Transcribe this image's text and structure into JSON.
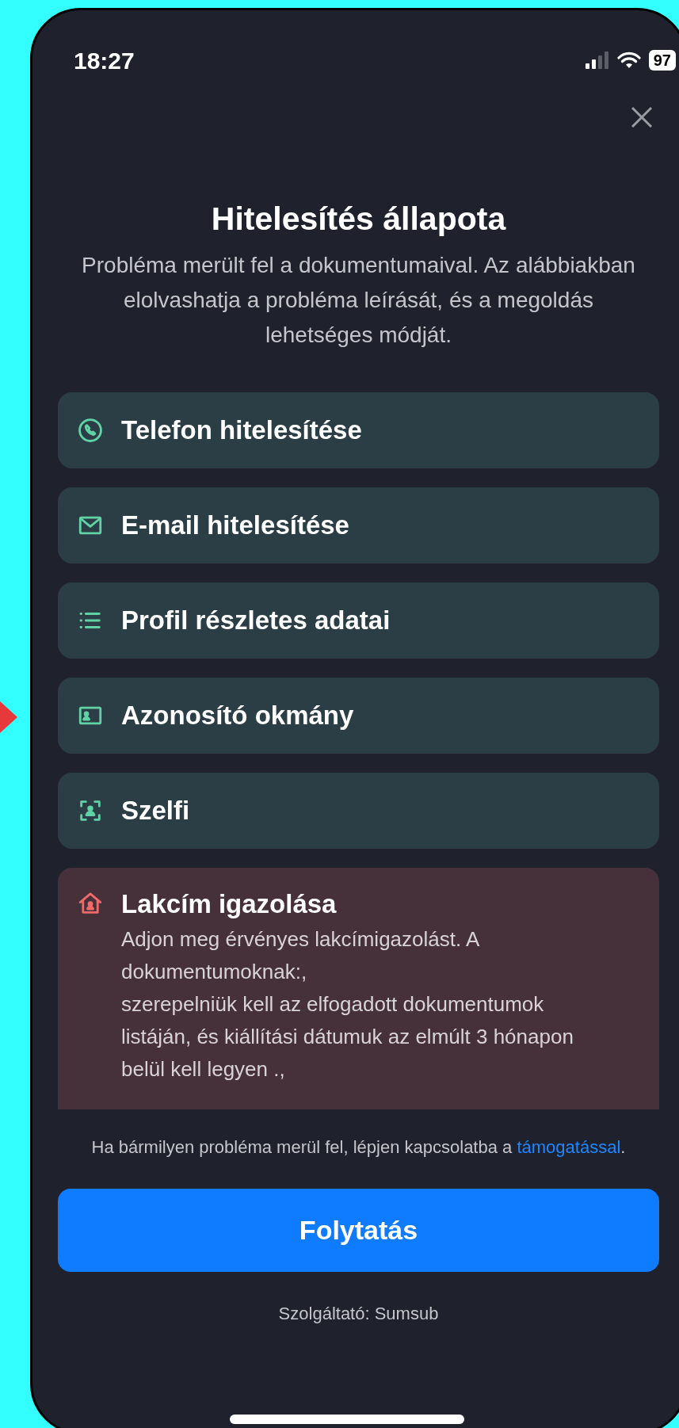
{
  "status_bar": {
    "time": "18:27",
    "battery": "97"
  },
  "title": "Hitelesítés állapota",
  "subtitle": "Probléma merült fel a dokumentumaival. Az alábbiakban elolvashatja a probléma leírását, és a megoldás lehetséges módját.",
  "steps": [
    {
      "kind": "phone",
      "error": false,
      "label": "Telefon hitelesítése"
    },
    {
      "kind": "email",
      "error": false,
      "label": "E-mail hitelesítése"
    },
    {
      "kind": "profile",
      "error": false,
      "label": "Profil részletes adatai"
    },
    {
      "kind": "id",
      "error": false,
      "label": "Azonosító okmány"
    },
    {
      "kind": "selfie",
      "error": false,
      "label": "Szelfi"
    },
    {
      "kind": "address",
      "error": true,
      "label": "Lakcím igazolása",
      "description": "Adjon meg érvényes lakcímigazolást. A dokumentumoknak:,\nszerepelniük kell az elfogadott dokumentumok listáján, és kiállítási dátumuk az elmúlt 3 hónapon belül kell legyen .,"
    }
  ],
  "support": {
    "text": "Ha bármilyen probléma merül fel, lépjen kapcsolatba a",
    "link": "támogatással",
    "suffix": "."
  },
  "primary_button": "Folytatás",
  "footer": "Szolgáltató: Sumsub"
}
